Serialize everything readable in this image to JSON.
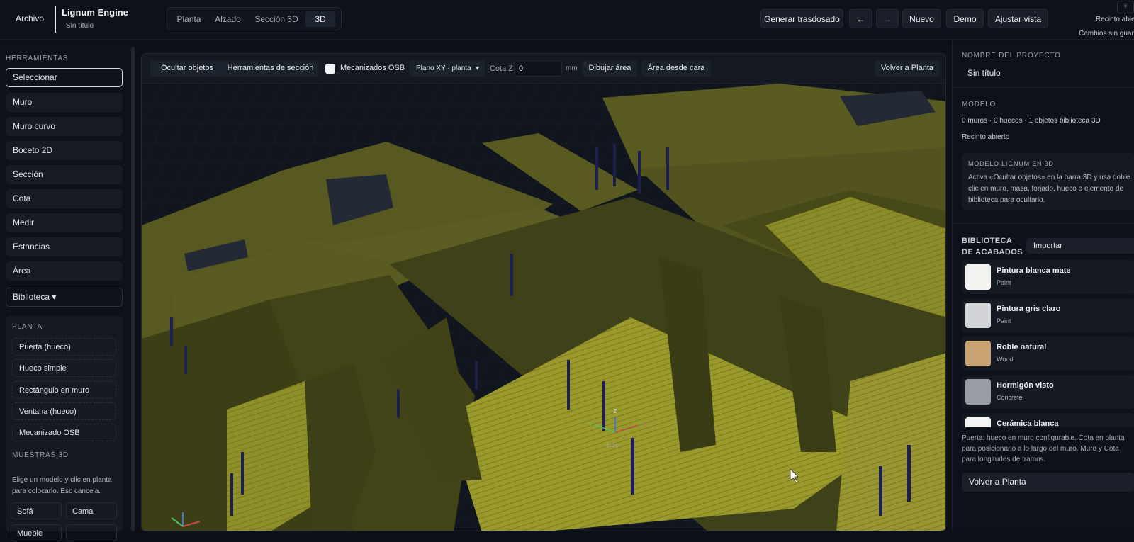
{
  "header": {
    "menu": "Archivo",
    "app_title": "Lignum Engine",
    "doc_subtitle": "Sin título",
    "view_tabs": [
      {
        "label": "Planta",
        "active": false
      },
      {
        "label": "Alzado",
        "active": false
      },
      {
        "label": "Sección 3D",
        "active": false
      },
      {
        "label": "3D",
        "active": true
      }
    ],
    "actions": {
      "generate": "Generar trasdosado",
      "undo": "←",
      "redo": "→",
      "new": "Nuevo",
      "demo": "Demo",
      "fit": "Ajustar vista"
    },
    "status_top": "Recinto abierto",
    "status_bottom": "Cambios sin guardar"
  },
  "left": {
    "tools_header": "HERRAMIENTAS",
    "tools": [
      {
        "label": "Seleccionar",
        "active": true
      },
      {
        "label": "Muro"
      },
      {
        "label": "Muro curvo"
      },
      {
        "label": "Boceto 2D"
      },
      {
        "label": "Sección"
      },
      {
        "label": "Cota"
      },
      {
        "label": "Medir"
      },
      {
        "label": "Estancias"
      },
      {
        "label": "Área"
      },
      {
        "label": "Biblioteca ▾"
      }
    ],
    "planta_header": "PLANTA",
    "planta_items": [
      "Puerta (hueco)",
      "Hueco simple",
      "Rectángulo en muro",
      "Ventana (hueco)",
      "Mecanizado OSB"
    ],
    "samples_header": "MUESTRAS 3D",
    "samples_note": "Elige un modelo y clic en planta para colocarlo. Esc cancela.",
    "samples": [
      "Sofá",
      "Cama",
      "Mueble",
      ""
    ]
  },
  "viewport": {
    "toolbar": {
      "hide_objects": "Ocultar objetos",
      "section_tools": "Herramientas de sección",
      "osb_label": "Mecanizados OSB",
      "osb_checked": false,
      "plane_select": "Plano XY · planta",
      "cota_label": "Cota Z",
      "cota_value": "0",
      "unit": "mm",
      "draw_area": "Dibujar área",
      "area_from_face": "Área desde cara",
      "back_to_plan": "Volver a Planta"
    },
    "gizmo": {
      "x": "X",
      "y": "Y",
      "z": "Z",
      "origin": "0.0.0"
    },
    "colors": {
      "floor": "#9b9a2d",
      "wall": "#3d3f16",
      "grid": "#1a2030",
      "opening": "#1b1f52"
    }
  },
  "right": {
    "project_header": "NOMBRE DEL PROYECTO",
    "project_name": "Sin título",
    "model_header": "MODELO",
    "model_stats": "0 muros · 0 huecos · 1 objetos biblioteca 3D",
    "model_status": "Recinto abierto",
    "info_header": "MODELO LIGNUM EN 3D",
    "info_text": "Activa «Ocultar objetos» en la barra 3D y usa doble clic en muro, masa, forjado, hueco o elemento de biblioteca para ocultarlo.",
    "library_header": "BIBLIOTECA DE ACABADOS",
    "import": "Importar",
    "finishes": [
      {
        "name": "Pintura blanca mate",
        "type": "Paint",
        "color": "#f2f2ee"
      },
      {
        "name": "Pintura gris claro",
        "type": "Paint",
        "color": "#d2d4d8"
      },
      {
        "name": "Roble natural",
        "type": "Wood",
        "color": "#c9a273"
      },
      {
        "name": "Hormigón visto",
        "type": "Concrete",
        "color": "#9a9da6"
      },
      {
        "name": "Cerámica blanca",
        "type": "",
        "color": "#f4f4f4"
      }
    ],
    "hint": "Puerta: hueco en muro configurable. Cota en planta para posicionarlo a lo largo del muro. Muro y Cota para longitudes de tramos.",
    "back_to_plan": "Volver a Planta"
  }
}
